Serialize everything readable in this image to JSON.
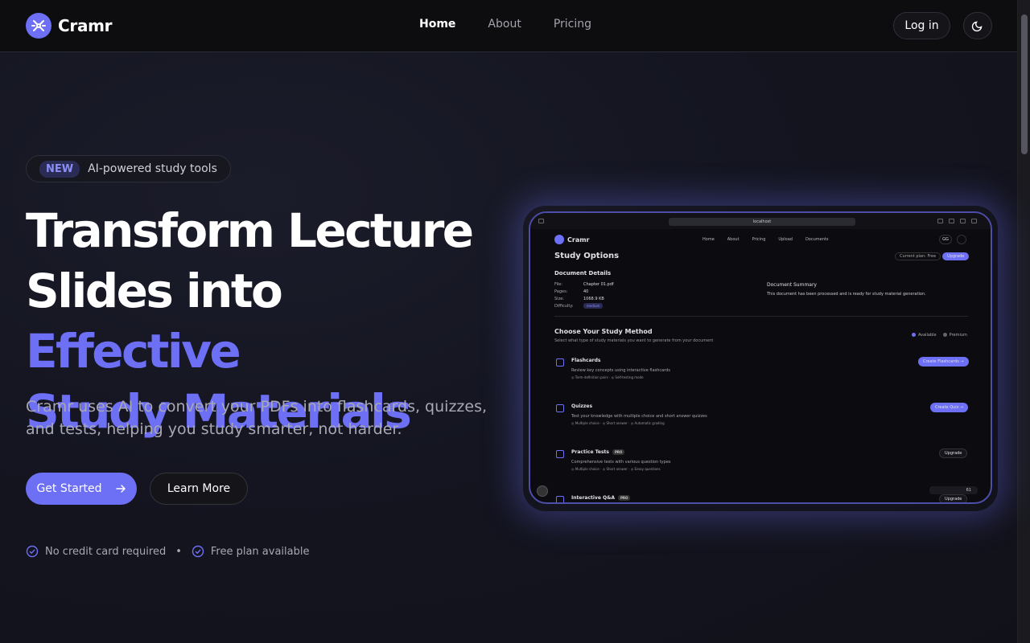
{
  "nav": {
    "brand": "Cramr",
    "links": [
      "Home",
      "About",
      "Pricing"
    ],
    "login": "Log in"
  },
  "hero": {
    "badge_tag": "NEW",
    "badge_text": "AI-powered study tools",
    "headline_line1": "Transform Lecture",
    "headline_line2_plain": "Slides into ",
    "headline_line2_accent": "Effective",
    "headline_line3_accent": "Study Materials",
    "subtext": "Cramr uses AI to convert your PDFs into flashcards, quizzes, and tests, helping you study smarter, not harder.",
    "cta_primary": "Get Started",
    "cta_secondary": "Learn More",
    "feature1": "No credit card required",
    "separator": "•",
    "feature2": "Free plan available"
  },
  "mock": {
    "url": "localhost",
    "brand": "Cramr",
    "links": [
      "Home",
      "About",
      "Pricing",
      "Upload",
      "Documents"
    ],
    "user": "GG",
    "title": "Study Options",
    "plan": "Current plan: Free",
    "upgrade": "Upgrade",
    "doc_details": "Document Details",
    "rows": [
      {
        "label": "File:",
        "value": "Chapter 01.pdf"
      },
      {
        "label": "Pages:",
        "value": "40"
      },
      {
        "label": "Size:",
        "value": "1068.9 KB"
      },
      {
        "label": "Difficulty:",
        "value": ""
      }
    ],
    "difficulty": "medium",
    "summary_heading": "Document Summary",
    "summary_text": "This document has been processed and is ready for study material generation.",
    "choose_title": "Choose Your Study Method",
    "choose_sub": "Select what type of study materials you want to generate from your document",
    "legend_available": "Available",
    "legend_premium": "Premium",
    "cards": [
      {
        "title": "Flashcards",
        "desc": "Review key concepts using interactive flashcards",
        "tags": "◎ Term-definition pairs  ·  ◎ Self-testing mode",
        "button": "Create Flashcards →",
        "pro": ""
      },
      {
        "title": "Quizzes",
        "desc": "Test your knowledge with multiple choice and short answer quizzes",
        "tags": "◎ Multiple choice  ·  ◎ Short answer  ·  ◎ Automatic grading",
        "button": "Create Quiz →",
        "pro": ""
      },
      {
        "title": "Practice Tests",
        "desc": "Comprehensive tests with various question types",
        "tags": "◎ Multiple choice  ·  ◎ Short answer  ·  ◎ Essay questions",
        "button": "Upgrade",
        "pro": "PRO"
      },
      {
        "title": "Interactive Q&A",
        "desc": "",
        "tags": "",
        "button": "Upgrade",
        "pro": "PRO"
      }
    ],
    "bottom_status": "61"
  },
  "colors": {
    "accent": "#6d6ff5",
    "bg": "#141520",
    "nav_bg": "#0d0d10"
  }
}
